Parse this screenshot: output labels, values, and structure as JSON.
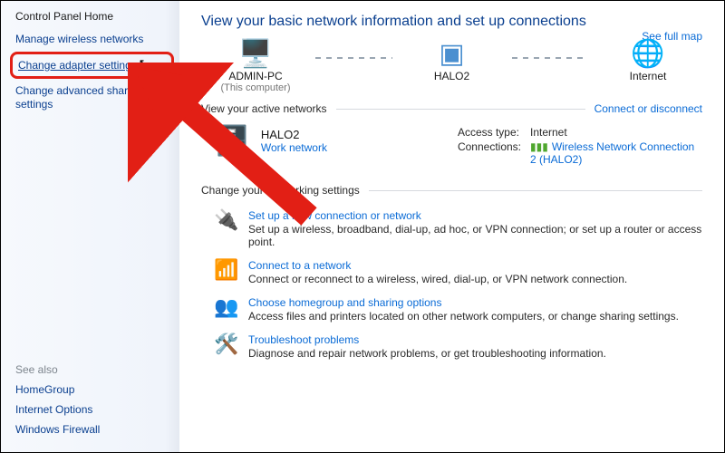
{
  "sidebar": {
    "home": "Control Panel Home",
    "manage_wireless": "Manage wireless networks",
    "change_adapter": "Change adapter settings",
    "change_advanced": "Change advanced sharing settings",
    "see_also_hdr": "See also",
    "see_also": {
      "homegroup": "HomeGroup",
      "internet_options": "Internet Options",
      "windows_firewall": "Windows Firewall"
    }
  },
  "main": {
    "title": "View your basic network information and set up connections",
    "see_full_map": "See full map",
    "map": {
      "node1": "ADMIN-PC",
      "node1_sub": "(This computer)",
      "node2": "HALO2",
      "node3": "Internet"
    },
    "active_hdr": "View your active networks",
    "connect_link": "Connect or disconnect",
    "active": {
      "name": "HALO2",
      "type": "Work network",
      "access_k": "Access type:",
      "access_v": "Internet",
      "conn_k": "Connections:",
      "conn_v": "Wireless Network Connection 2 (HALO2)"
    },
    "change_hdr": "Change your networking settings",
    "items": {
      "setup": {
        "t": "Set up a new connection or network",
        "d": "Set up a wireless, broadband, dial-up, ad hoc, or VPN connection; or set up a router or access point."
      },
      "connect": {
        "t": "Connect to a network",
        "d": "Connect or reconnect to a wireless, wired, dial-up, or VPN network connection."
      },
      "homegroup": {
        "t": "Choose homegroup and sharing options",
        "d": "Access files and printers located on other network computers, or change sharing settings."
      },
      "troubleshoot": {
        "t": "Troubleshoot problems",
        "d": "Diagnose and repair network problems, or get troubleshooting information."
      }
    }
  }
}
